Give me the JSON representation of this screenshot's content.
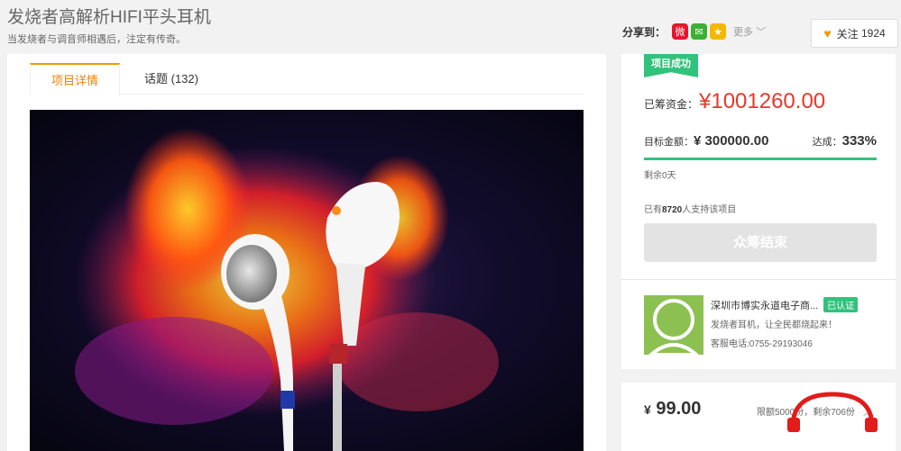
{
  "header": {
    "title": "发烧者高解析HIFI平头耳机",
    "subtitle": "当发烧者与调音师相遇后，注定有传奇。"
  },
  "share": {
    "label": "分享到：",
    "icons": [
      "weibo-icon",
      "wechat-icon",
      "qzone-icon"
    ],
    "more_label": "更多"
  },
  "follow": {
    "label": "关注",
    "count": "1924"
  },
  "tabs": [
    {
      "label": "项目详情",
      "active": true
    },
    {
      "label": "话题 (132)",
      "active": false
    }
  ],
  "project": {
    "status_badge": "项目成功",
    "raised_label": "已筹资金：",
    "raised_amount": "¥1001260.00",
    "target_label": "目标金额：",
    "target_amount": "¥ 300000.00",
    "reach_label": "达成：",
    "reach_percent": "333%",
    "progress": 1.0,
    "remaining": "剩余0天",
    "backers_prefix": "已有",
    "backers_count": "8720",
    "backers_suffix": "人支持该项目",
    "ended_button": "众筹结束"
  },
  "sponsor": {
    "name": "深圳市博实永道电子商...",
    "verified": "已认证",
    "slogan": "发烧者耳机，让全民都烧起来！",
    "phone": "客服电话:0755-29193046"
  },
  "reward": {
    "currency": "¥",
    "price": "99.00",
    "limit_text": "限额5000份，剩余706份"
  },
  "colors": {
    "accent_orange": "#f39800",
    "success_green": "#31c27c",
    "price_red": "#e83828"
  }
}
